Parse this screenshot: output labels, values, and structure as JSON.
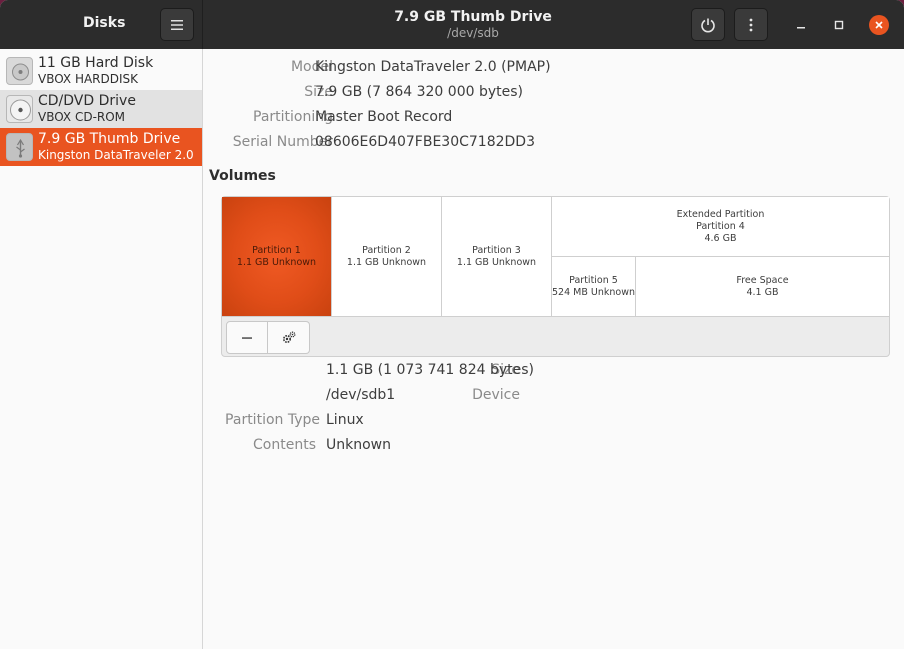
{
  "app": {
    "sidebar_title": "Disks"
  },
  "header": {
    "title": "7.9 GB Thumb Drive",
    "subtitle": "/dev/sdb"
  },
  "sidebar": {
    "items": [
      {
        "name": "11 GB Hard Disk",
        "model": "VBOX HARDDISK",
        "icon": "harddisk-icon"
      },
      {
        "name": "CD/DVD Drive",
        "model": "VBOX CD-ROM",
        "icon": "optical-drive-icon"
      },
      {
        "name": "7.9 GB Thumb Drive",
        "model": "Kingston DataTraveler 2.0",
        "icon": "usb-drive-icon"
      }
    ]
  },
  "drive": {
    "model_label": "Model",
    "model": "Kingston DataTraveler 2.0 (PMAP)",
    "size_label": "Size",
    "size": "7.9 GB (7 864 320 000 bytes)",
    "partitioning_label": "Partitioning",
    "partitioning": "Master Boot Record",
    "serial_label": "Serial Number",
    "serial": "08606E6D407FBE30C7182DD3"
  },
  "volumes": {
    "title": "Volumes",
    "p1": {
      "name": "Partition 1",
      "detail": "1.1 GB Unknown"
    },
    "p2": {
      "name": "Partition 2",
      "detail": "1.1 GB Unknown"
    },
    "p3": {
      "name": "Partition 3",
      "detail": "1.1 GB Unknown"
    },
    "ext": {
      "name": "Extended Partition",
      "sub": "Partition 4",
      "detail": "4.6 GB"
    },
    "p5": {
      "name": "Partition 5",
      "detail": "524 MB Unknown"
    },
    "free": {
      "name": "Free Space",
      "detail": "4.1 GB"
    }
  },
  "selected_partition": {
    "size_label": "Size",
    "size": "1.1 GB (1 073 741 824 bytes)",
    "device_label": "Device",
    "device": "/dev/sdb1",
    "type_label": "Partition Type",
    "type": "Linux",
    "contents_label": "Contents",
    "contents": "Unknown"
  },
  "colors": {
    "accent": "#e95420",
    "header_bg": "#2c2c2c"
  }
}
